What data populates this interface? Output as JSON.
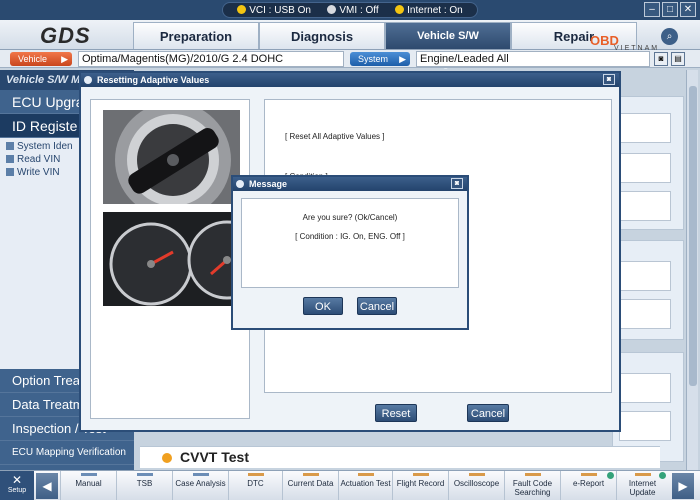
{
  "status_bar": {
    "vci": "VCI : USB On",
    "vmi": "VMI : Off",
    "internet": "Internet : On"
  },
  "window_controls": [
    "–",
    "□",
    "✕"
  ],
  "logo": {
    "text": "GDS"
  },
  "watermark_logo": {
    "main": "OBD",
    "sub": "VIETNAM"
  },
  "main_tabs": [
    {
      "label": "Preparation"
    },
    {
      "label": "Diagnosis"
    },
    {
      "label": "Vehicle S/W Management"
    },
    {
      "label": "Repair"
    }
  ],
  "vehicle_bar": {
    "vehicle_label": "Vehicle",
    "vehicle_value": "Optima/Magentis(MG)/2010/G 2.4 DOHC",
    "system_label": "System",
    "system_value": "Engine/Leaded All"
  },
  "sidebar": {
    "header": "Vehicle S/W M",
    "items_top": [
      {
        "label": "ECU Upgra"
      },
      {
        "label": "ID Registe"
      }
    ],
    "sub_items": [
      {
        "label": "System Iden"
      },
      {
        "label": "Read VIN"
      },
      {
        "label": "Write VIN"
      }
    ],
    "items_bottom": [
      {
        "label": "Option Treatm"
      },
      {
        "label": "Data Treatm"
      },
      {
        "label": "Inspection / Test"
      },
      {
        "label": "ECU Mapping Verification"
      }
    ]
  },
  "cvvt_section": {
    "title": "CVVT Test"
  },
  "dialog": {
    "title": "Resetting Adaptive Values",
    "line1": "[ Reset All Adaptive Values ]",
    "line2": "[ Condition ]",
    "reset_button": "Reset",
    "cancel_button": "Cancel"
  },
  "message_box": {
    "title": "Message",
    "question": "Are you sure? (Ok/Cancel)",
    "condition": "[ Condition : IG. On, ENG. Off ]",
    "ok_button": "OK",
    "cancel_button": "Cancel"
  },
  "toolbar": {
    "setup": "Setup",
    "items": [
      {
        "label": "Manual"
      },
      {
        "label": "TSB"
      },
      {
        "label": "Case Analysis"
      },
      {
        "label": "DTC"
      },
      {
        "label": "Current Data"
      },
      {
        "label": "Actuation Test"
      },
      {
        "label": "Flight Record"
      },
      {
        "label": "Oscilloscope"
      },
      {
        "label": "Fault Code Searching"
      },
      {
        "label": "e-Report"
      },
      {
        "label": "Internet Update"
      }
    ]
  },
  "colors": {
    "dark_blue": "#2b4d78",
    "sidebar_blue": "#3f638d",
    "accent_red": "#d91f26",
    "accent_orange": "#e85f28"
  }
}
